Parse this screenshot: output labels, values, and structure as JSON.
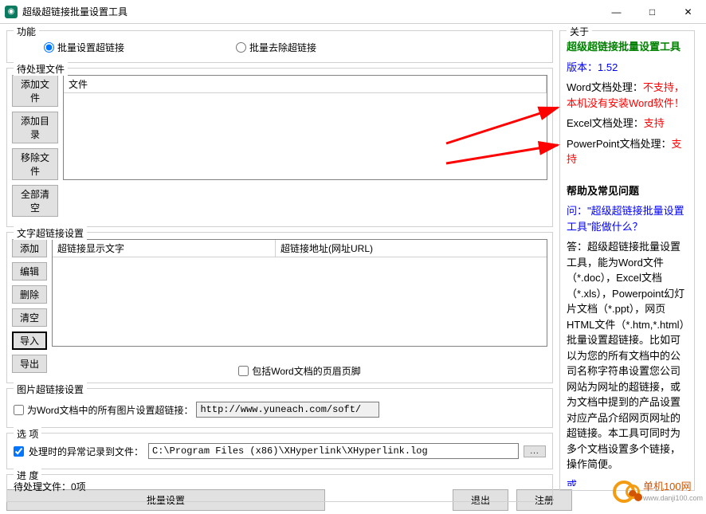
{
  "window": {
    "title": "超级超链接批量设置工具"
  },
  "function_group": {
    "title": "功能",
    "radio_set": "批量设置超链接",
    "radio_remove": "批量去除超链接"
  },
  "pending": {
    "title": "待处理文件",
    "btn_add_file": "添加文件",
    "btn_add_dir": "添加目录",
    "btn_remove": "移除文件",
    "btn_clear": "全部清空",
    "col_file": "文件"
  },
  "text_link": {
    "title": "文字超链接设置",
    "btn_add": "添加",
    "btn_edit": "编辑",
    "btn_delete": "删除",
    "btn_clear": "清空",
    "btn_import": "导入",
    "btn_export": "导出",
    "col_text": "超链接显示文字",
    "col_url": "超链接地址(网址URL)",
    "chk_header": "包括Word文档的页眉页脚"
  },
  "image_link": {
    "title": "图片超链接设置",
    "chk_label": "为Word文档中的所有图片设置超链接：",
    "url_placeholder": "http://www.yuneach.com/soft/"
  },
  "options": {
    "title": "选  项",
    "chk_log": "处理时的异常记录到文件：",
    "log_path": "C:\\Program Files (x86)\\XHyperlink\\XHyperlink.log",
    "browse": "..."
  },
  "progress": {
    "title": "进  度",
    "label": "待处理文件：0项"
  },
  "bottom": {
    "batch_set": "批量设置",
    "exit": "退出",
    "register": "注册"
  },
  "about": {
    "title": "关于",
    "app_name": "超级超链接批量设置工具",
    "version_label": "版本：",
    "version_value": "1.52",
    "word_label": "Word文档处理：",
    "word_status": "不支持，本机没有安装Word软件！",
    "excel_label": "Excel文档处理：",
    "excel_status": "支持",
    "ppt_label": "PowerPoint文档处理：",
    "ppt_status": "支持",
    "help_heading": "帮助及常见问题",
    "q_label": "问：",
    "q_text": "\"超级超链接批量设置工具\"能做什么？",
    "a_text": "答：超级超链接批量设置工具，能为Word文件（*.doc），Excel文档（*.xls），Powerpoint幻灯片文档（*.ppt），网页HTML文件（*.htm,*.html）批量设置超链接。比如可以为您的所有文档中的公司名称字符串设置您公司网站为网址的超链接，或为文档中提到的产品设置对应产品介绍网页网址的超链接。本工具可同时为多个文档设置多个链接，操作简便。",
    "more": "或..."
  },
  "watermark": "单机100网"
}
